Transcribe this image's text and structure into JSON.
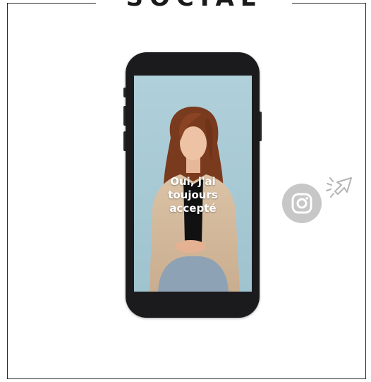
{
  "heading": "SOCIAL",
  "video": {
    "caption_lines": [
      "Oui, j'ai",
      "toujours",
      "accepté"
    ]
  },
  "icons": {
    "social": "instagram-icon",
    "pointer": "click-pointer-icon"
  },
  "colors": {
    "frame": "#2b2b2b",
    "phone_body": "#1b1b1d",
    "screen_background": "#a9cbd6",
    "badge": "#c7c7c7"
  }
}
